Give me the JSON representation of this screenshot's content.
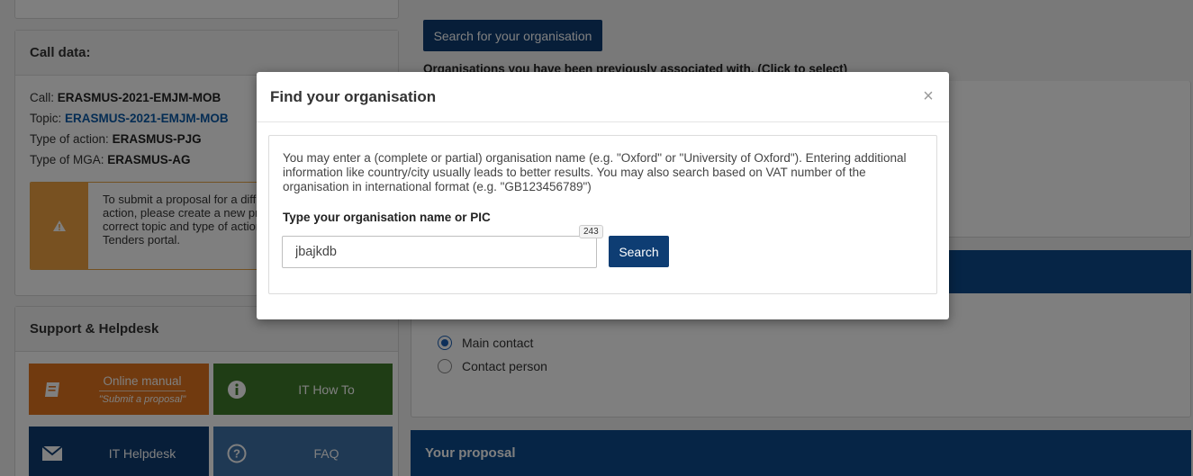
{
  "call_data": {
    "heading": "Call data:",
    "call_label": "Call:",
    "call_value": "ERASMUS-2021-EMJM-MOB",
    "topic_label": "Topic:",
    "topic_value": "ERASMUS-2021-EMJM-MOB",
    "type_action_label": "Type of action:",
    "type_action_value": "ERASMUS-PJG",
    "type_mga_label": "Type of MGA:",
    "type_mga_value": "ERASMUS-AG",
    "warning_text": "To submit a proposal for a diff\naction, please create a new pro\ncorrect topic and type of action\nTenders portal."
  },
  "support": {
    "heading": "Support & Helpdesk",
    "online_manual": "Online manual",
    "online_manual_sub": "\"Submit a proposal\"",
    "it_how_to": "IT How To",
    "it_helpdesk": "IT Helpdesk",
    "faq": "FAQ"
  },
  "main": {
    "search_org_button": "Search for your organisation",
    "previously_associated": "Organisations you have been previously associated with. (Click to select)",
    "radio_main_contact": "Main contact",
    "radio_contact_person": "Contact person",
    "your_proposal": "Your proposal"
  },
  "modal": {
    "title": "Find your organisation",
    "close_glyph": "×",
    "description": "You may enter a (complete or partial) organisation name (e.g. \"Oxford\" or \"University of Oxford\"). Entering additional information like country/city usually leads to better results. You may also search based on VAT number of the organisation in international format (e.g. \"GB123456789\")",
    "input_label": "Type your organisation name or PIC",
    "input_value": "jbajkdb",
    "char_count": "243",
    "search_button": "Search"
  },
  "colors": {
    "primary_blue": "#0e3d73",
    "bar_blue": "#0c4a8c",
    "warning_orange": "#f0a342",
    "manual_orange": "#e2751e",
    "howto_green": "#3f7a2b",
    "faq_blue": "#3e72a8"
  },
  "icons": {
    "warning": "warning-triangle-icon",
    "manual": "book-icon",
    "howto": "info-circle-icon",
    "helpdesk": "envelope-icon",
    "faq": "question-circle-icon",
    "close": "close-icon"
  }
}
